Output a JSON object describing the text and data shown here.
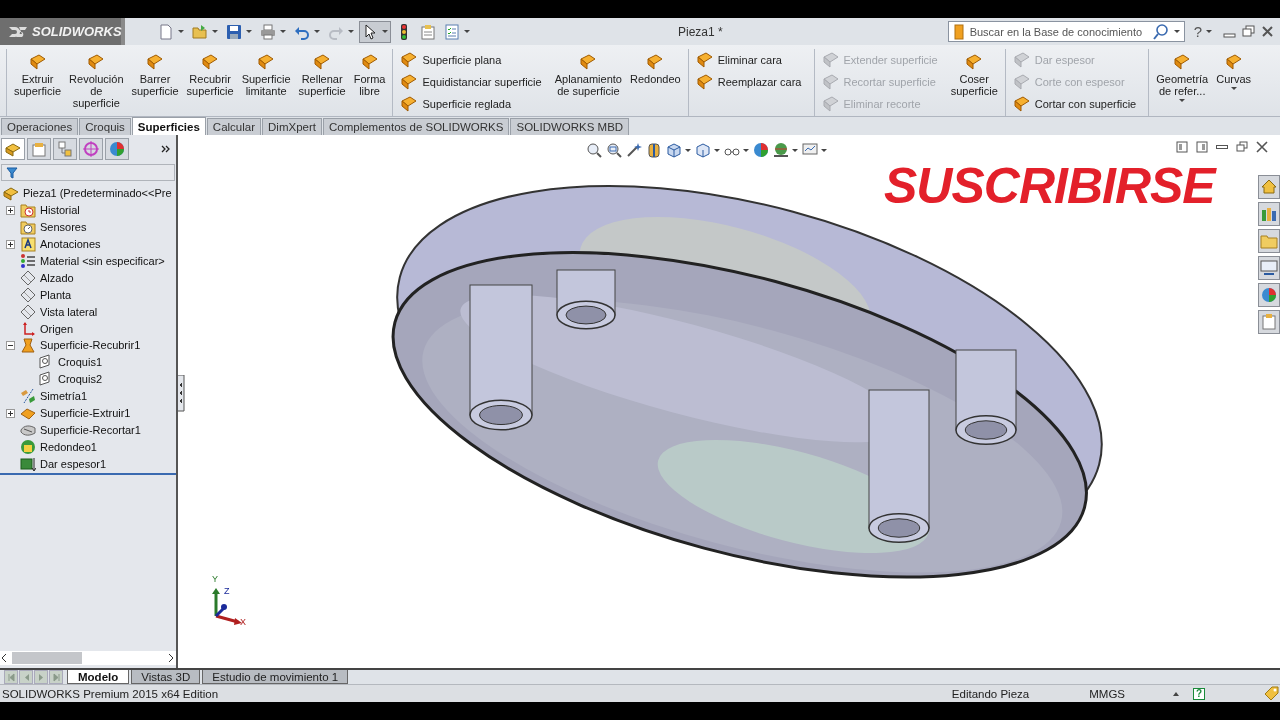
{
  "window": {
    "brand": "SOLIDWORKS",
    "title": "Pieza1 *"
  },
  "search": {
    "placeholder": "Buscar en la Base de conocimiento"
  },
  "help": "?",
  "ribbon": [
    [
      {
        "kind": "large",
        "label": "Extruir\nsuperficie",
        "dropdown": false
      },
      {
        "kind": "large",
        "label": "Revolución\nde\nsuperficie",
        "dropdown": false
      },
      {
        "kind": "large",
        "label": "Barrer\nsuperficie",
        "dropdown": false
      },
      {
        "kind": "large",
        "label": "Recubrir\nsuperficie",
        "dropdown": false
      },
      {
        "kind": "large",
        "label": "Superficie\nlimitante",
        "dropdown": false
      },
      {
        "kind": "large",
        "label": "Rellenar\nsuperficie",
        "dropdown": false
      },
      {
        "kind": "large",
        "label": "Forma\nlibre",
        "dropdown": false
      }
    ],
    [
      {
        "kind": "stack",
        "buttons": [
          {
            "label": "Superficie plana",
            "disabled": false
          },
          {
            "label": "Equidistanciar superficie",
            "disabled": false
          },
          {
            "label": "Superficie reglada",
            "disabled": false
          }
        ]
      },
      {
        "kind": "large",
        "label": "Aplanamiento\nde superficie",
        "dropdown": false
      },
      {
        "kind": "large",
        "label": "Redondeo",
        "dropdown": false
      }
    ],
    [
      {
        "kind": "stack",
        "buttons": [
          {
            "label": "Eliminar cara",
            "disabled": false
          },
          {
            "label": "Reemplazar cara",
            "disabled": false
          }
        ]
      }
    ],
    [
      {
        "kind": "stack",
        "buttons": [
          {
            "label": "Extender superficie",
            "disabled": true
          },
          {
            "label": "Recortar superficie",
            "disabled": true
          },
          {
            "label": "Eliminar recorte",
            "disabled": true
          }
        ]
      },
      {
        "kind": "large",
        "label": "Coser\nsuperficie",
        "dropdown": false
      }
    ],
    [
      {
        "kind": "stack",
        "buttons": [
          {
            "label": "Dar espesor",
            "disabled": true
          },
          {
            "label": "Corte con espesor",
            "disabled": true
          },
          {
            "label": "Cortar con superficie",
            "disabled": false
          }
        ]
      }
    ],
    [
      {
        "kind": "large",
        "label": "Geometría\nde refer...",
        "dropdown": true
      },
      {
        "kind": "large",
        "label": "Curvas",
        "dropdown": true
      }
    ]
  ],
  "command_tabs": [
    {
      "label": "Operaciones",
      "selected": false
    },
    {
      "label": "Croquis",
      "selected": false
    },
    {
      "label": "Superficies",
      "selected": true
    },
    {
      "label": "Calcular",
      "selected": false
    },
    {
      "label": "DimXpert",
      "selected": false
    },
    {
      "label": "Complementos de SOLIDWORKS",
      "selected": false
    },
    {
      "label": "SOLIDWORKS MBD",
      "selected": false
    }
  ],
  "manager_tabs": [
    {
      "selected": true
    },
    {
      "selected": false
    },
    {
      "selected": false
    },
    {
      "selected": false
    },
    {
      "selected": false
    }
  ],
  "feature_tree": {
    "root": {
      "label": "Pieza1 (Predeterminado<<Pre",
      "kind": "part",
      "children": [
        {
          "label": "Historial",
          "kind": "history",
          "expanded": false
        },
        {
          "label": "Sensores",
          "kind": "sensor"
        },
        {
          "label": "Anotaciones",
          "kind": "annotation",
          "expanded": false
        },
        {
          "label": "Material <sin especificar>",
          "kind": "material"
        },
        {
          "label": "Alzado",
          "kind": "plane"
        },
        {
          "label": "Planta",
          "kind": "plane"
        },
        {
          "label": "Vista lateral",
          "kind": "plane"
        },
        {
          "label": "Origen",
          "kind": "origin"
        },
        {
          "label": "Superficie-Recubrir1",
          "kind": "loft",
          "expanded": true,
          "children": [
            {
              "label": "Croquis1",
              "kind": "sketch"
            },
            {
              "label": "Croquis2",
              "kind": "sketch"
            }
          ]
        },
        {
          "label": "Simetría1",
          "kind": "mirror"
        },
        {
          "label": "Superficie-Extruir1",
          "kind": "extrude",
          "expanded": false
        },
        {
          "label": "Superficie-Recortar1",
          "kind": "trim"
        },
        {
          "label": "Redondeo1",
          "kind": "fillet"
        },
        {
          "label": "Dar espesor1",
          "kind": "thicken"
        }
      ]
    }
  },
  "viewport": {
    "overlay_text": "SUSCRIBIRSE",
    "triad": {
      "y": "Y",
      "z": "Z",
      "x": "X"
    }
  },
  "bottom_tabs": [
    {
      "label": "Modelo",
      "selected": true
    },
    {
      "label": "Vistas 3D",
      "selected": false
    },
    {
      "label": "Estudio de movimiento 1",
      "selected": false
    }
  ],
  "status_bar": {
    "product": "SOLIDWORKS Premium 2015 x64 Edition",
    "mode": "Editando Pieza",
    "units": "MMGS",
    "help": "?"
  }
}
